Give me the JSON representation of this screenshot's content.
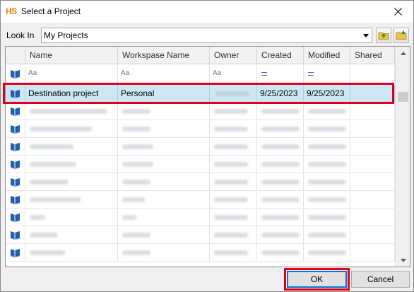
{
  "window": {
    "app_logo": "HS",
    "title": "Select a Project"
  },
  "lookin": {
    "label": "Look In",
    "value": "My Projects"
  },
  "grid": {
    "headers": [
      "Name",
      "Workspase Name",
      "Owner",
      "Created",
      "Modified",
      "Shared"
    ],
    "filter_text": "Aa",
    "selected_row": {
      "name": "Destination project",
      "workspace": "Personal",
      "created": "9/25/2023",
      "modified": "9/25/2023"
    },
    "blurred_row_count": 9
  },
  "buttons": {
    "ok": "OK",
    "cancel": "Cancel"
  },
  "colors": {
    "highlight": "#e0001b",
    "selection": "#cde8f4",
    "logo": "#f07a00",
    "book_icon": "#1f5fae"
  },
  "icons": {
    "row": "book-icon",
    "close": "close-icon",
    "up_folder": "folder-up-icon",
    "new_folder": "new-folder-icon"
  }
}
